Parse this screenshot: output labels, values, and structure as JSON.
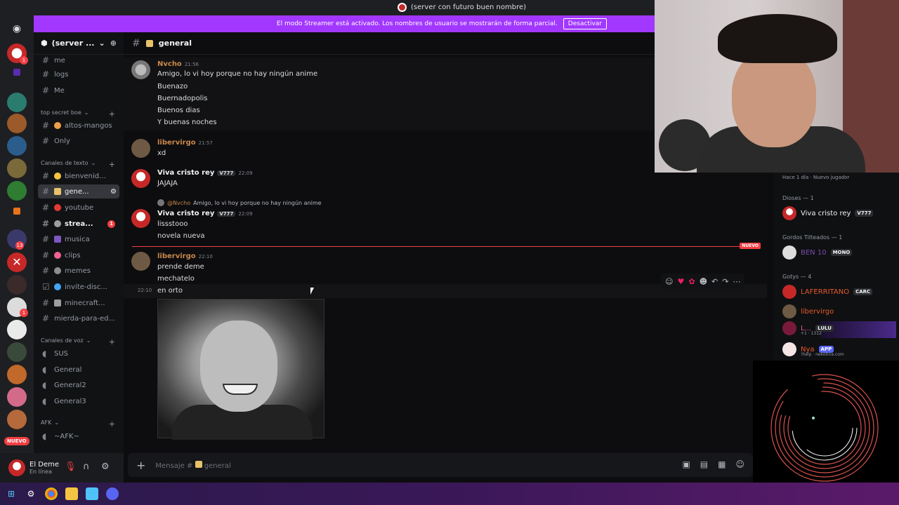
{
  "window": {
    "title": "(server con futuro buen nombre)"
  },
  "banner": {
    "text": "El modo Streamer está activado. Los nombres de usuario se mostrarán de forma parcial.",
    "button": "Desactivar",
    "color": "#a238ff"
  },
  "server": {
    "name": "(server ..."
  },
  "rail": {
    "badges": [
      "1",
      "13",
      "1",
      "1",
      "1"
    ],
    "nuevo": "NUEVO"
  },
  "sidebar": {
    "top_channels": [
      "me",
      "logs",
      "Me"
    ],
    "cat_secret": "top secret boe",
    "ch_altos": "altos-mangos",
    "ch_only": "Only",
    "cat_text": "Canales de texto",
    "text_channels": [
      {
        "label": "bienvenid..."
      },
      {
        "label": "gene..."
      },
      {
        "label": "youtube"
      },
      {
        "label": "strea...",
        "badge": "1"
      },
      {
        "label": "musica"
      },
      {
        "label": "clips"
      },
      {
        "label": "memes"
      },
      {
        "label": "invite-disc..."
      },
      {
        "label": "minecraft..."
      },
      {
        "label": "mierda-para-ed..."
      }
    ],
    "cat_voice": "Canales de voz",
    "voice_channels": [
      "SUS",
      "General",
      "General2",
      "General3"
    ],
    "cat_afk": "AFK",
    "afk_channel": "~AFK~"
  },
  "user": {
    "name": "El Deme",
    "status": "En línea"
  },
  "chat": {
    "channel": "general",
    "new_label": "NUEVO",
    "messages": [
      {
        "author": "Nvcho",
        "time": "21:56",
        "color": "#c9884a",
        "lines": [
          "Amigo, lo vi hoy porque no hay ningún anime",
          "Buenazo",
          "Buernadopolis",
          "Buenos dias",
          "Y buenas noches"
        ]
      },
      {
        "author": "libervirgo",
        "time": "21:57",
        "color": "#c9884a",
        "lines": [
          "xd"
        ]
      },
      {
        "author": "Viva cristo rey",
        "time": "22:09",
        "tag": "V777",
        "color": "#f2f3f5",
        "lines": [
          "JAJAJA"
        ]
      },
      {
        "author": "Viva cristo rey",
        "time": "22:09",
        "tag": "V777",
        "color": "#f2f3f5",
        "reply_to": "@Nvcho",
        "reply_text": "Amigo, lo vi hoy porque no hay ningún anime",
        "lines": [
          "lissstooo",
          "novela nueva"
        ]
      },
      {
        "author": "libervirgo",
        "time": "22:10",
        "color": "#c9884a",
        "lines": [
          "prende deme",
          "mechatelo",
          "en orto"
        ]
      }
    ],
    "hover_time": "22:10",
    "placeholder": "Mensaje #",
    "placeholder_channel": "general"
  },
  "members": {
    "hint_time": "Hace 1 día",
    "hint_badge": "Nuevo jugador",
    "groups": [
      {
        "name": "Dioses — 1",
        "members": [
          {
            "name": "Viva cristo rey",
            "tag": "V777"
          }
        ]
      },
      {
        "name": "Gordos Tilteados — 1",
        "members": [
          {
            "name": "BEN 10",
            "tag": "MONO"
          }
        ]
      },
      {
        "name": "Gotys — 4",
        "members": [
          {
            "name": "LAFERRITANO",
            "tag": "CARC"
          },
          {
            "name": "libervirgo"
          },
          {
            "name": "L...",
            "tag": "LULU",
            "sub": "+1 · 1312"
          },
          {
            "name": "Nya",
            "tag": "APP",
            "sub": "!help · nekotina.com"
          }
        ]
      }
    ]
  },
  "icons": [
    "discord-icon",
    "hash-icon",
    "plus-icon",
    "gear-icon",
    "headphones-icon",
    "mute-icon",
    "gift-icon",
    "gif-icon",
    "sticker-icon",
    "emoji-icon",
    "reply-icon",
    "forward-icon",
    "more-icon",
    "windows-icon",
    "chrome-icon",
    "folder-icon",
    "notepad-icon"
  ]
}
